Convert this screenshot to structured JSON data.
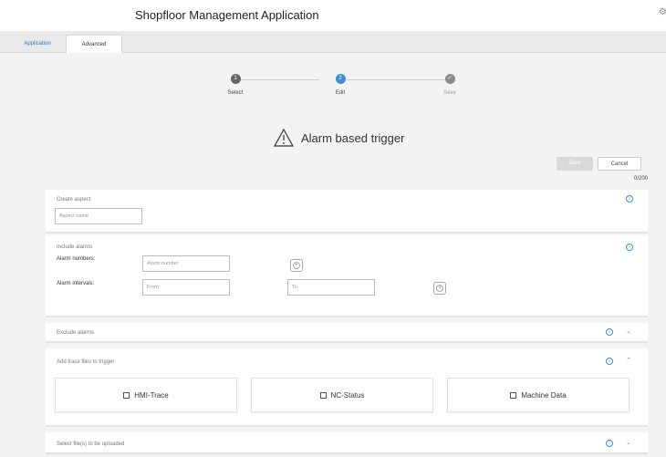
{
  "app": {
    "title": "Shopfloor Management Application"
  },
  "tabs": [
    {
      "label": "Application"
    },
    {
      "label": "Advanced"
    }
  ],
  "stepper": {
    "steps": [
      {
        "number": "1",
        "label": "Select",
        "state": "done"
      },
      {
        "number": "2",
        "label": "Edit",
        "state": "active"
      },
      {
        "number": "3",
        "label": "Save",
        "state": "pending"
      }
    ]
  },
  "trigger": {
    "title": "Alarm based trigger",
    "icon": "warning-triangle-icon"
  },
  "actions": {
    "save_label": "Save",
    "cancel_label": "Cancel",
    "char_counter": "0/200"
  },
  "create_aspect": {
    "label": "Create aspect",
    "placeholder": "Aspect name"
  },
  "include_alarms": {
    "label": "Include alarms",
    "alarm_numbers_label": "Alarm numbers:",
    "alarm_number_placeholder": "Alarm number",
    "alarm_intervals_label": "Alarm intervals:",
    "from_placeholder": "From",
    "to_placeholder": "To"
  },
  "exclude_alarms": {
    "label": "Exclude alarms"
  },
  "trace_files": {
    "label": "Add trace files to trigger",
    "options": [
      "HMI-Trace",
      "NC-Status",
      "Machine Data"
    ]
  },
  "upload": {
    "label": "Select file(s) to be uploaded"
  },
  "colors": {
    "accent": "#3a8fd6",
    "background": "#f3f3f3"
  }
}
